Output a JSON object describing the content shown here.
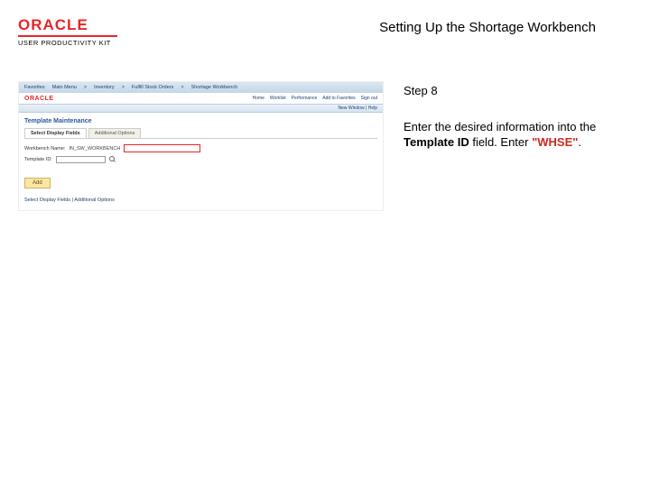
{
  "header": {
    "logo_text": "ORACLE",
    "upk_label": "USER PRODUCTIVITY KIT",
    "doc_title": "Setting Up the Shortage Workbench"
  },
  "instructions": {
    "step_label": "Step 8",
    "line1_pre": "Enter the desired information into the ",
    "line1_bold": "Template ID",
    "line1_post": " field. Enter ",
    "value": "\"WHSE\"",
    "line1_end": "."
  },
  "screenshot": {
    "topnav": [
      "Favorites",
      "Main Menu",
      "Inventory",
      "Fulfill Stock Orders",
      "Shortage Workbench"
    ],
    "brand": "ORACLE",
    "brand_links": [
      "Home",
      "Worklist",
      "Performance",
      "Add to Favorites",
      "Sign out"
    ],
    "subbar": "New Window | Help",
    "page_title": "Template Maintenance",
    "tabs": [
      "Select Display Fields",
      "Additional Options"
    ],
    "form": {
      "row1_label": "Workbench Name:",
      "row1_value": "IN_SW_WORKBENCH",
      "row2_label": "Template ID:"
    },
    "add_button": "Add",
    "footer": "Select Display Fields | Additional Options"
  }
}
